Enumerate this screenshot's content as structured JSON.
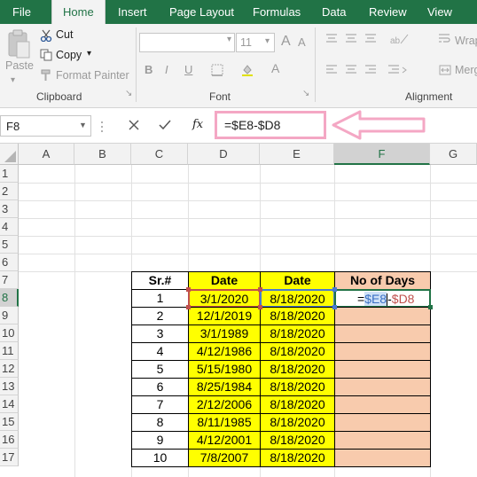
{
  "ribbon_tabs": [
    {
      "label": "File"
    },
    {
      "label": "Home"
    },
    {
      "label": "Insert"
    },
    {
      "label": "Page Layout"
    },
    {
      "label": "Formulas"
    },
    {
      "label": "Data"
    },
    {
      "label": "Review"
    },
    {
      "label": "View"
    }
  ],
  "clipboard": {
    "paste_label": "Paste",
    "cut_label": "Cut",
    "copy_label": "Copy",
    "format_painter_label": "Format Painter",
    "group_label": "Clipboard"
  },
  "font_group": {
    "font_size": "11",
    "bold": "B",
    "italic": "I",
    "underline": "U",
    "group_label": "Font"
  },
  "alignment_group": {
    "wrap_label": "Wrap",
    "merge_label": "Merg",
    "group_label": "Alignment"
  },
  "formula_bar": {
    "name_box": "F8",
    "fx_label": "fx",
    "formula": "=$E8-$D8"
  },
  "columns": [
    "A",
    "B",
    "C",
    "D",
    "E",
    "F",
    "G"
  ],
  "rows": [
    "1",
    "2",
    "3",
    "4",
    "5",
    "6",
    "7",
    "8",
    "9",
    "10",
    "11",
    "12",
    "13",
    "14",
    "15",
    "16",
    "17"
  ],
  "table": {
    "headers": [
      "Sr.#",
      "Date",
      "Date",
      "No of Days"
    ],
    "rows": [
      {
        "sr": "1",
        "d": "3/1/2020",
        "e": "8/18/2020"
      },
      {
        "sr": "2",
        "d": "12/1/2019",
        "e": "8/18/2020"
      },
      {
        "sr": "3",
        "d": "3/1/1989",
        "e": "8/18/2020"
      },
      {
        "sr": "4",
        "d": "4/12/1986",
        "e": "8/18/2020"
      },
      {
        "sr": "5",
        "d": "5/15/1980",
        "e": "8/18/2020"
      },
      {
        "sr": "6",
        "d": "8/25/1984",
        "e": "8/18/2020"
      },
      {
        "sr": "7",
        "d": "2/12/2006",
        "e": "8/18/2020"
      },
      {
        "sr": "8",
        "d": "8/11/1985",
        "e": "8/18/2020"
      },
      {
        "sr": "9",
        "d": "4/12/2001",
        "e": "8/18/2020"
      },
      {
        "sr": "10",
        "d": "7/8/2007",
        "e": "8/18/2020"
      }
    ],
    "editing_cell": {
      "eq": "=",
      "ref1": "$E8",
      "op": "-",
      "ref2": "$D8"
    }
  },
  "colors": {
    "excel_green": "#217346",
    "highlight_yellow": "#ffff00",
    "peach": "#f8cbad",
    "callout_pink": "#f4a7c4"
  }
}
